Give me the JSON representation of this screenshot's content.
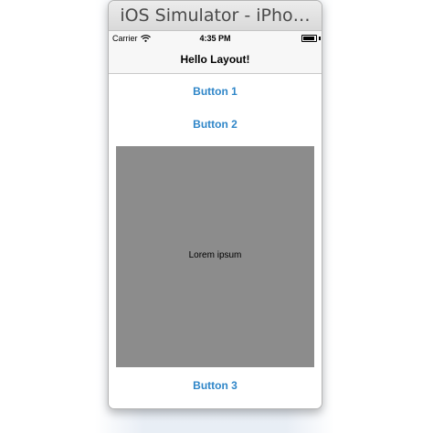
{
  "window": {
    "title": "iOS Simulator - iPho…"
  },
  "status_bar": {
    "carrier": "Carrier",
    "time": "4:35 PM"
  },
  "nav_bar": {
    "title": "Hello Layout!"
  },
  "buttons": [
    {
      "label": "Button 1"
    },
    {
      "label": "Button 2"
    },
    {
      "label": "Button 3"
    }
  ],
  "content_box": {
    "label": "Lorem ipsum",
    "color": "#8c8c8c"
  },
  "colors": {
    "button_tint": "#2f86c8",
    "nav_background": "#f7f7f7"
  },
  "icons": [
    "wifi-icon",
    "battery-icon"
  ]
}
